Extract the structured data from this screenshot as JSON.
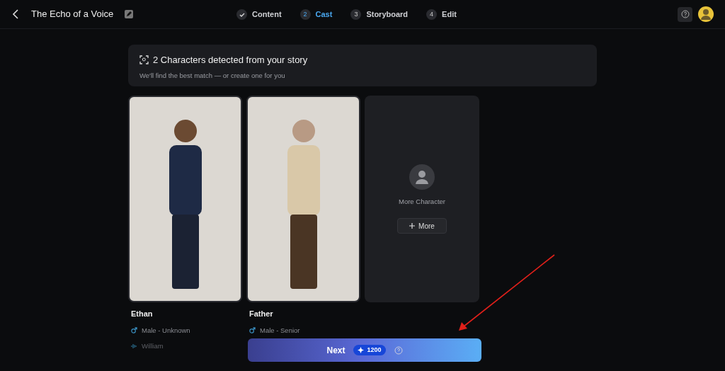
{
  "header": {
    "title": "The Echo of a Voice",
    "steps": [
      {
        "label": "Content",
        "done": true,
        "selected": false
      },
      {
        "marker": "2",
        "label": "Cast",
        "done": false,
        "selected": true
      },
      {
        "marker": "3",
        "label": "Storyboard",
        "done": false,
        "selected": false
      },
      {
        "marker": "4",
        "label": "Edit",
        "done": false,
        "selected": false
      }
    ]
  },
  "banner": {
    "title": "2 Characters detected from your story",
    "subtitle": "We'll find the best match — or create one for you"
  },
  "characters": [
    {
      "name": "Ethan",
      "gender": "Male - Unknown",
      "voice": "William"
    },
    {
      "name": "Father",
      "gender": "Male - Senior"
    }
  ],
  "more_card": {
    "label": "More Character",
    "button": "More"
  },
  "next_button": {
    "label": "Next",
    "cost": "1200"
  }
}
